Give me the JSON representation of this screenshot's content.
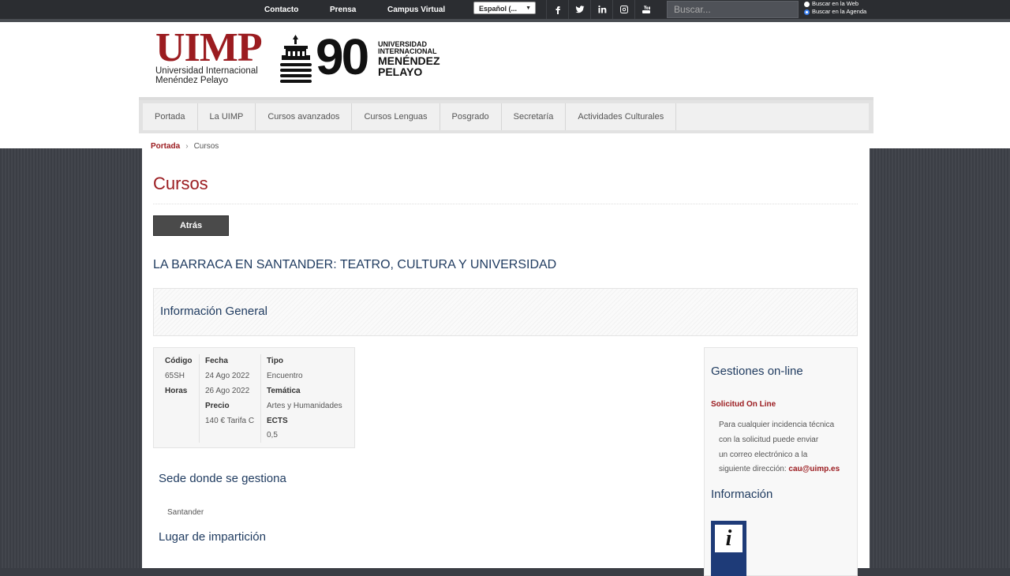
{
  "topbar": {
    "links": [
      "Contacto",
      "Prensa",
      "Campus Virtual"
    ],
    "language": "Español (...",
    "search_placeholder": "Buscar...",
    "radio_web": "Buscar en la Web",
    "radio_agenda": "Buscar en la Agenda",
    "social_icons": [
      "facebook-icon",
      "twitter-icon",
      "linkedin-icon",
      "instagram-icon",
      "youtube-icon"
    ]
  },
  "header": {
    "logo_main": "UIMP",
    "logo_line1": "Universidad Internacional",
    "logo_line2": "Menéndez Pelayo",
    "anniv_number": "90",
    "anniv_line1": "UNIVERSIDAD",
    "anniv_line2": "INTERNACIONAL",
    "anniv_line3": "MENÉNDEZ",
    "anniv_line4": "PELAYO"
  },
  "nav": {
    "items": [
      "Portada",
      "La UIMP",
      "Cursos avanzados",
      "Cursos Lenguas",
      "Posgrado",
      "Secretaría",
      "Actividades Culturales"
    ]
  },
  "breadcrumb": {
    "home": "Portada",
    "sep": "›",
    "current": "Cursos"
  },
  "main": {
    "page_title": "Cursos",
    "back_label": "Atrás",
    "course_title": "LA BARRACA EN SANTANDER: TEATRO, CULTURA Y UNIVERSIDAD",
    "info_heading": "Información General",
    "details": {
      "codigo_label": "Código",
      "codigo_value": "65SH",
      "horas_label": "Horas",
      "fecha_label": "Fecha",
      "fecha_start": "24 Ago 2022",
      "fecha_end": "26 Ago 2022",
      "precio_label": "Precio",
      "precio_value": "140 € Tarifa C",
      "tipo_label": "Tipo",
      "tipo_value": "Encuentro",
      "tematica_label": "Temática",
      "tematica_value": "Artes y Humanidades",
      "ects_label": "ECTS",
      "ects_value": "0,5"
    },
    "sede_heading": "Sede donde se gestiona",
    "sede_value": "Santander",
    "lugar_heading": "Lugar de impartición"
  },
  "sidebar": {
    "gestiones_heading": "Gestiones on-line",
    "solicitud_link": "Solicitud On Line",
    "help_line1": "Para cualquier incidencia técnica",
    "help_line2": "con la solicitud puede enviar",
    "help_line3": "un correo electrónico a la",
    "help_line4": "siguiente dirección:",
    "help_email": "cau@uimp.es",
    "informacion_heading": "Información",
    "info_icon_glyph": "i"
  },
  "colors": {
    "brand_red": "#9b1c20",
    "heading_blue": "#1e3a5f",
    "topbar": "#2b2d31"
  }
}
